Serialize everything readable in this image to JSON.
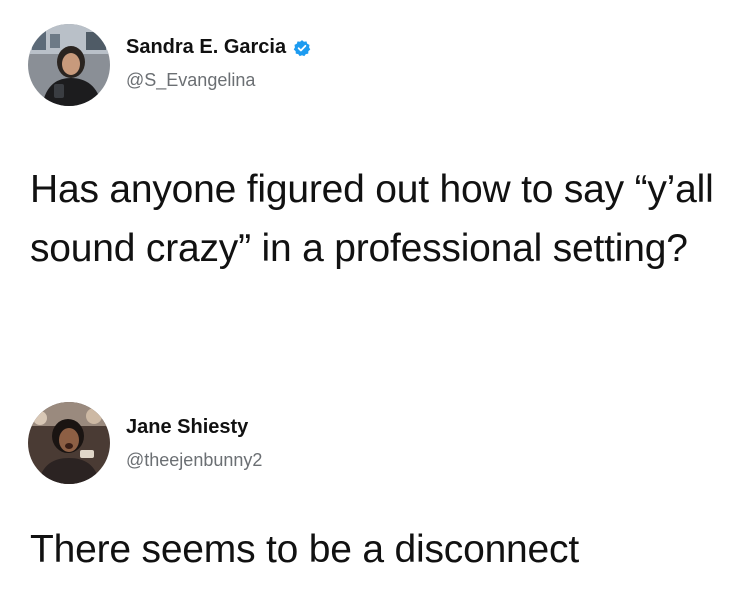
{
  "tweets": [
    {
      "display_name": "Sandra E. Garcia",
      "verified": true,
      "handle": "@S_Evangelina",
      "avatar_icon": "profile-photo",
      "text": "Has anyone figured out how to say “y’all sound crazy” in a professional setting?"
    },
    {
      "display_name": "Jane Shiesty",
      "verified": false,
      "handle": "@theejenbunny2",
      "avatar_icon": "profile-photo",
      "text": "There seems to be a disconnect"
    }
  ],
  "colors": {
    "verified_badge": "#1d9bf0",
    "handle": "#6b6f73",
    "text": "#111111",
    "background": "#ffffff"
  }
}
